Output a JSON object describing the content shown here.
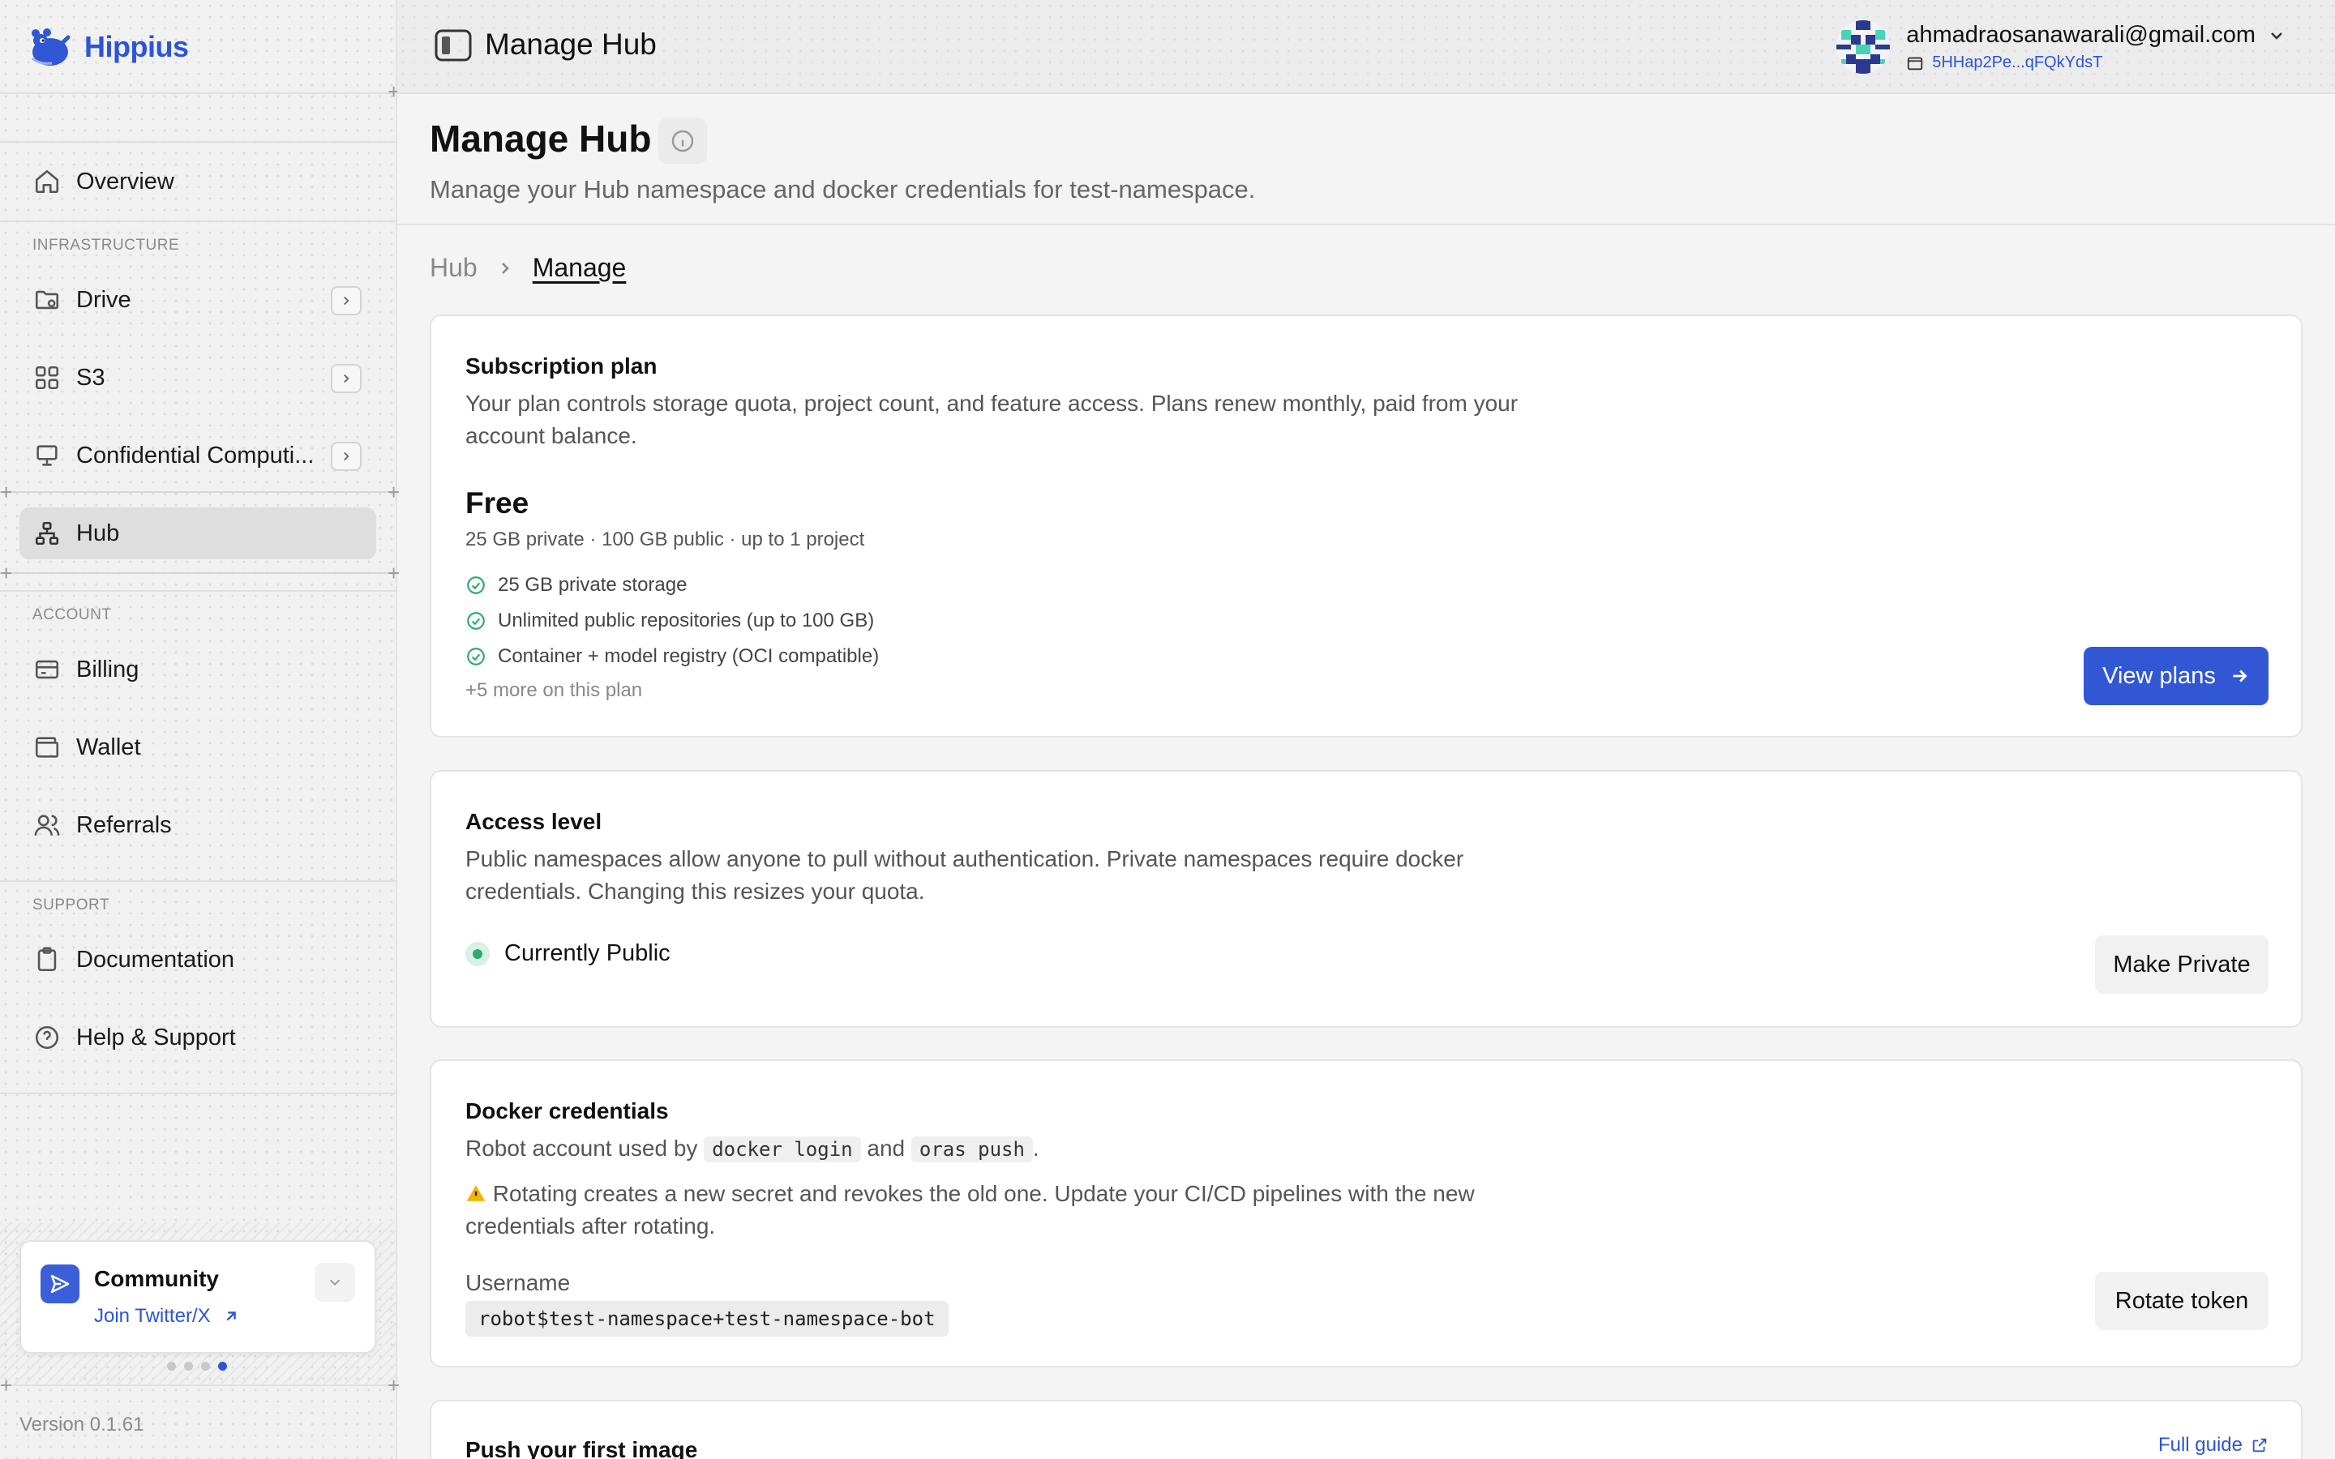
{
  "app": {
    "name": "Hippius",
    "version": "Version 0.1.61"
  },
  "sidebar": {
    "overview": "Overview",
    "sections": {
      "infrastructure": "INFRASTRUCTURE",
      "account": "ACCOUNT",
      "support": "SUPPORT"
    },
    "items": [
      {
        "label": "Drive",
        "icon": "folder-icon"
      },
      {
        "label": "S3",
        "icon": "grid-icon"
      },
      {
        "label": "Confidential Computi...",
        "icon": "monitor-icon"
      },
      {
        "label": "Hub",
        "icon": "hierarchy-icon",
        "active": true
      },
      {
        "label": "Billing",
        "icon": "credit-card-icon"
      },
      {
        "label": "Wallet",
        "icon": "wallet-icon"
      },
      {
        "label": "Referrals",
        "icon": "users-icon"
      },
      {
        "label": "Documentation",
        "icon": "clipboard-icon"
      },
      {
        "label": "Help & Support",
        "icon": "help-circle-icon"
      }
    ],
    "community": {
      "title": "Community",
      "link": "Join Twitter/X",
      "pages": 4,
      "current_page": 4
    }
  },
  "topbar": {
    "title": "Manage Hub",
    "account": {
      "email": "ahmadraosanawarali@gmail.com",
      "wallet": "5HHap2Pe...qFQkYdsT"
    }
  },
  "page": {
    "title": "Manage Hub",
    "subtitle": "Manage your Hub namespace and docker credentials for test-namespace.",
    "breadcrumb": {
      "root": "Hub",
      "current": "Manage"
    }
  },
  "subscription": {
    "title": "Subscription plan",
    "description": "Your plan controls storage quota, project count, and feature access. Plans renew monthly, paid from your account balance.",
    "plan_name": "Free",
    "plan_summary": "25 GB private · 100 GB public · up to 1 project",
    "features": [
      "25 GB private storage",
      "Unlimited public repositories (up to 100 GB)",
      "Container + model registry (OCI compatible)"
    ],
    "more": "+5 more on this plan",
    "button": "View plans"
  },
  "access": {
    "title": "Access level",
    "description": "Public namespaces allow anyone to pull without authentication. Private namespaces require docker credentials. Changing this resizes your quota.",
    "status": "Currently Public",
    "button": "Make Private"
  },
  "docker": {
    "title": "Docker credentials",
    "desc_prefix": "Robot account used by",
    "cmd1": "docker login",
    "desc_and": "and",
    "cmd2": "oras push",
    "desc_end": ".",
    "warning": "Rotating creates a new secret and revokes the old one. Update your CI/CD pipelines with the new credentials after rotating.",
    "username_label": "Username",
    "username": "robot$test-namespace+test-namespace-bot",
    "button": "Rotate token"
  },
  "push": {
    "title": "Push your first image",
    "guide": "Full guide"
  },
  "colors": {
    "accent": "#3157d5",
    "success": "#2eaa6a",
    "warning": "#f2b400"
  }
}
